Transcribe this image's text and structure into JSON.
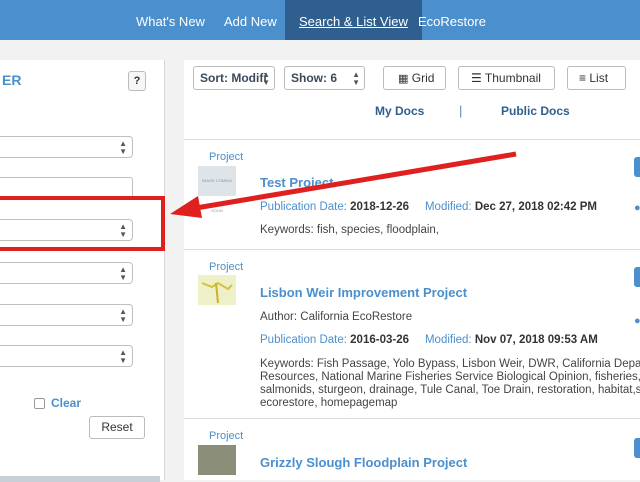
{
  "nav": {
    "items": [
      "What's New",
      "Add New",
      "Search & List View",
      "EcoRestore"
    ]
  },
  "filter": {
    "title": "ER",
    "help": "?",
    "clear": "Clear",
    "reset": "Reset"
  },
  "toolbar": {
    "sort": "Sort: Modifi",
    "show": "Show: 6",
    "grid": "Grid",
    "thumbnail": "Thumbnail",
    "list": "List"
  },
  "tabs": {
    "my_docs": "My Docs",
    "separator": "|",
    "public_docs": "Public Docs"
  },
  "results": [
    {
      "type": "Project",
      "title": "Test Project",
      "pub_label": "Publication Date:",
      "pub_date": "2018-12-26",
      "mod_label": "Modified:",
      "mod_date": "Dec 27, 2018 02:42 PM",
      "keywords": "Keywords: fish, species, floodplain,",
      "thumb_text": "IMAGE COMING SOON"
    },
    {
      "type": "Project",
      "title": "Lisbon Weir Improvement Project",
      "author": "Author: California EcoRestore",
      "pub_label": "Publication Date:",
      "pub_date": "2016-03-26",
      "mod_label": "Modified:",
      "mod_date": "Nov 07, 2018 09:53 AM",
      "keywords_lines": [
        "Keywords: Fish Passage, Yolo Bypass, Lisbon Weir, DWR, California Departm",
        "Resources, National Marine Fisheries Service Biological Opinion, fisheries, f",
        "salmonids, sturgeon, drainage, Tule Canal, Toe Drain, restoration, habitat,s",
        "ecorestore, homepagemap"
      ]
    },
    {
      "type": "Project",
      "title": "Grizzly Slough Floodplain Project"
    }
  ],
  "colors": {
    "nav_bg": "#4b8fcc",
    "nav_active": "#2f5f8f",
    "link": "#4b8fcc",
    "annotation_red": "#e0201f"
  }
}
